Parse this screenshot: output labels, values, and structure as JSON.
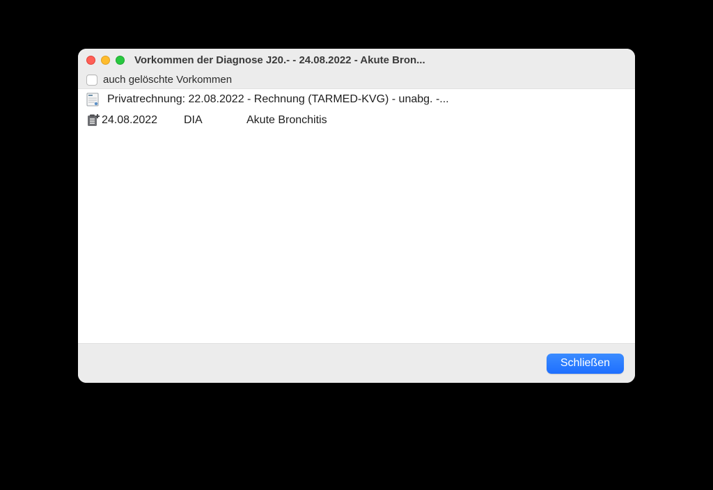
{
  "window": {
    "title": "Vorkommen der Diagnose J20.- - 24.08.2022 - Akute Bron..."
  },
  "toolbar": {
    "deleted_checkbox_label": "auch gelöschte Vorkommen",
    "deleted_checked": false
  },
  "rows": [
    {
      "icon": "invoice-doc-icon",
      "text": "Privatrechnung: 22.08.2022 - Rechnung (TARMED-KVG) - unabg. -..."
    },
    {
      "icon": "diagnosis-clipboard-icon",
      "date": "24.08.2022",
      "type": "DIA",
      "desc": "Akute Bronchitis"
    }
  ],
  "footer": {
    "close_label": "Schließen"
  }
}
